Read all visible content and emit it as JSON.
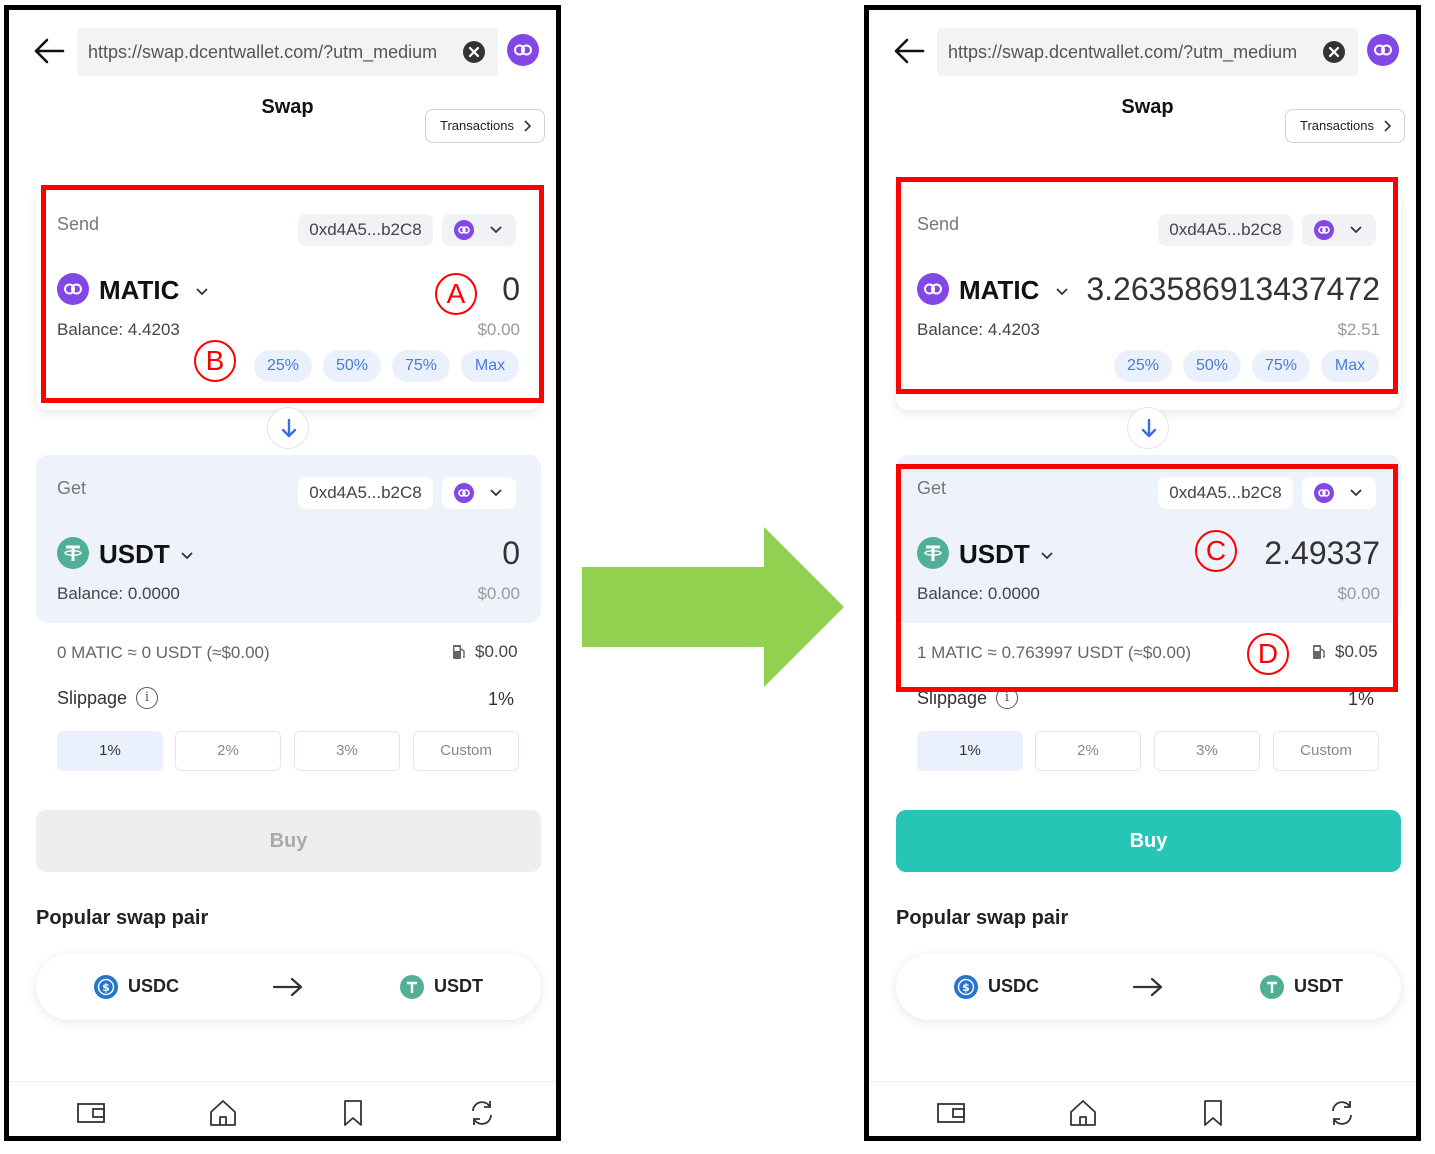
{
  "left": {
    "url": "https://swap.dcentwallet.com/?utm_medium",
    "title": "Swap",
    "transactions_label": "Transactions",
    "send": {
      "label": "Send",
      "address": "0xd4A5...b2C8",
      "token": "MATIC",
      "amount": "0",
      "balance": "Balance: 4.4203",
      "usd": "$0.00",
      "percent_buttons": [
        "25%",
        "50%",
        "75%",
        "Max"
      ]
    },
    "get": {
      "label": "Get",
      "address": "0xd4A5...b2C8",
      "token": "USDT",
      "amount": "0",
      "balance": "Balance: 0.0000",
      "usd": "$0.00"
    },
    "rate": "0 MATIC ≈ 0 USDT (≈$0.00)",
    "gas": "$0.00",
    "slippage_label": "Slippage",
    "slippage_value": "1%",
    "slippage_options": [
      "1%",
      "2%",
      "3%",
      "Custom"
    ],
    "buy_label": "Buy",
    "buy_state": "disabled",
    "popular_title": "Popular swap pair",
    "pair_from": "USDC",
    "pair_to": "USDT",
    "markers": [
      "A",
      "B"
    ]
  },
  "right": {
    "url": "https://swap.dcentwallet.com/?utm_medium",
    "title": "Swap",
    "transactions_label": "Transactions",
    "send": {
      "label": "Send",
      "address": "0xd4A5...b2C8",
      "token": "MATIC",
      "amount": "3.263586913437472",
      "balance": "Balance: 4.4203",
      "usd": "$2.51",
      "percent_buttons": [
        "25%",
        "50%",
        "75%",
        "Max"
      ]
    },
    "get": {
      "label": "Get",
      "address": "0xd4A5...b2C8",
      "token": "USDT",
      "amount": "2.49337",
      "balance": "Balance: 0.0000",
      "usd": "$0.00"
    },
    "rate": "1 MATIC ≈ 0.763997 USDT (≈$0.00)",
    "gas": "$0.05",
    "slippage_label": "Slippage",
    "slippage_value": "1%",
    "slippage_options": [
      "1%",
      "2%",
      "3%",
      "Custom"
    ],
    "buy_label": "Buy",
    "buy_state": "enabled",
    "popular_title": "Popular swap pair",
    "pair_from": "USDC",
    "pair_to": "USDT",
    "markers": [
      "C",
      "D"
    ]
  },
  "colors": {
    "polygon": "#8247e5",
    "tether": "#50af95",
    "usdc": "#2775ca",
    "accent_blue": "#4a7bd9",
    "buy_enabled": "#27c5b5",
    "highlight": "#ff0000",
    "transition_arrow": "#92d050"
  },
  "icons": {
    "back": "arrow-left-icon",
    "clear": "close-circle-icon",
    "network": "polygon-icon",
    "swap_direction": "arrow-down-icon",
    "gas": "gas-pump-icon",
    "info": "info-icon",
    "nav": [
      "wallet-icon",
      "home-icon",
      "bookmark-icon",
      "refresh-icon"
    ]
  }
}
